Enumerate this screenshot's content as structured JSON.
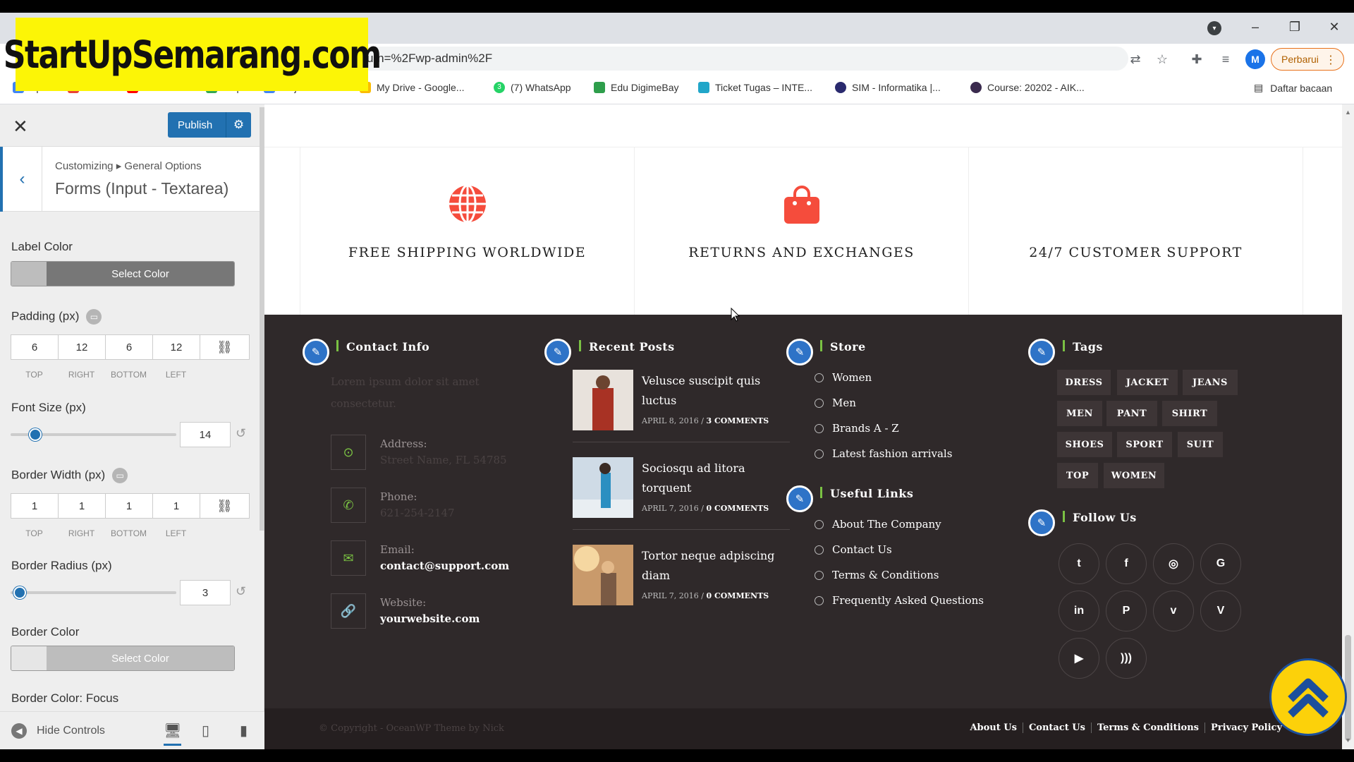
{
  "watermark": "StartUpSemarang.com",
  "browser": {
    "url": "urn=%2Fwp-admin%2F",
    "profile_initial": "M",
    "update_label": "Perbarui",
    "bookmarks": [
      "Apl",
      "Gmail",
      "YouTube",
      "Maps",
      "Terjemahkan",
      "My Drive - Google...",
      "(7) WhatsApp",
      "Edu DigimeBay",
      "Ticket Tugas – INTE...",
      "SIM - Informatika |...",
      "Course: 20202 - AIK..."
    ],
    "whatsapp_count": "3",
    "reading_list": "Daftar bacaan"
  },
  "customizer": {
    "publish_label": "Publish",
    "breadcrumb_root": "Customizing",
    "breadcrumb_section": "General Options",
    "section_title": "Forms (Input - Textarea)",
    "label_color": "Label Color",
    "select_color": "Select Color",
    "padding_label": "Padding (px)",
    "padding_values": [
      "6",
      "12",
      "6",
      "12"
    ],
    "dim_labels": [
      "TOP",
      "RIGHT",
      "BOTTOM",
      "LEFT"
    ],
    "font_size_label": "Font Size (px)",
    "font_size_value": "14",
    "font_size_slider_fraction": 0.12,
    "border_width_label": "Border Width (px)",
    "border_width_values": [
      "1",
      "1",
      "1",
      "1"
    ],
    "border_radius_label": "Border Radius (px)",
    "border_radius_value": "3",
    "border_radius_slider_fraction": 0.02,
    "border_color_label": "Border Color",
    "border_color_focus_label": "Border Color: Focus",
    "hide_controls": "Hide Controls"
  },
  "preview": {
    "features": [
      "FREE SHIPPING WORLDWIDE",
      "RETURNS AND EXCHANGES",
      "24/7 CUSTOMER SUPPORT"
    ],
    "contact": {
      "title": "Contact Info",
      "lorem": "Lorem ipsum dolor sit amet consectetur.",
      "items": [
        {
          "label": "Address:",
          "value": "Street Name, FL 54785"
        },
        {
          "label": "Phone:",
          "value": "621-254-2147"
        },
        {
          "label": "Email:",
          "value": "contact@support.com"
        },
        {
          "label": "Website:",
          "value": "yourwebsite.com"
        }
      ]
    },
    "recent_posts": {
      "title": "Recent Posts",
      "posts": [
        {
          "title": "Velusce suscipit quis luctus",
          "date": "APRIL 8, 2016",
          "comments": "3 COMMENTS"
        },
        {
          "title": "Sociosqu ad litora torquent",
          "date": "APRIL 7, 2016",
          "comments": "0 COMMENTS"
        },
        {
          "title": "Tortor neque adpiscing diam",
          "date": "APRIL 7, 2016",
          "comments": "0 COMMENTS"
        }
      ]
    },
    "store": {
      "title": "Store",
      "items": [
        "Women",
        "Men",
        "Brands A - Z",
        "Latest fashion arrivals"
      ]
    },
    "useful_links": {
      "title": "Useful Links",
      "items": [
        "About The Company",
        "Contact Us",
        "Terms & Conditions",
        "Frequently Asked Questions"
      ]
    },
    "tags": {
      "title": "Tags",
      "items": [
        "DRESS",
        "JACKET",
        "JEANS",
        "MEN",
        "PANT",
        "SHIRT",
        "SHOES",
        "SPORT",
        "SUIT",
        "TOP",
        "WOMEN"
      ]
    },
    "follow": {
      "title": "Follow Us",
      "icons": [
        "twitter-icon",
        "facebook-icon",
        "instagram-icon",
        "google-plus-icon",
        "linkedin-icon",
        "pinterest-icon",
        "vimeo-icon",
        "vine-icon",
        "youtube-icon",
        "rss-icon"
      ]
    },
    "copyright": "© Copyright - OceanWP Theme by Nick",
    "footer_links": [
      "About Us",
      "Contact Us",
      "Terms & Conditions",
      "Privacy Policy"
    ]
  },
  "colors": {
    "accent_red": "#f54c3c",
    "wp_blue": "#2271b1",
    "footer_bg": "#2f292a",
    "green_accent": "#7ac143"
  }
}
